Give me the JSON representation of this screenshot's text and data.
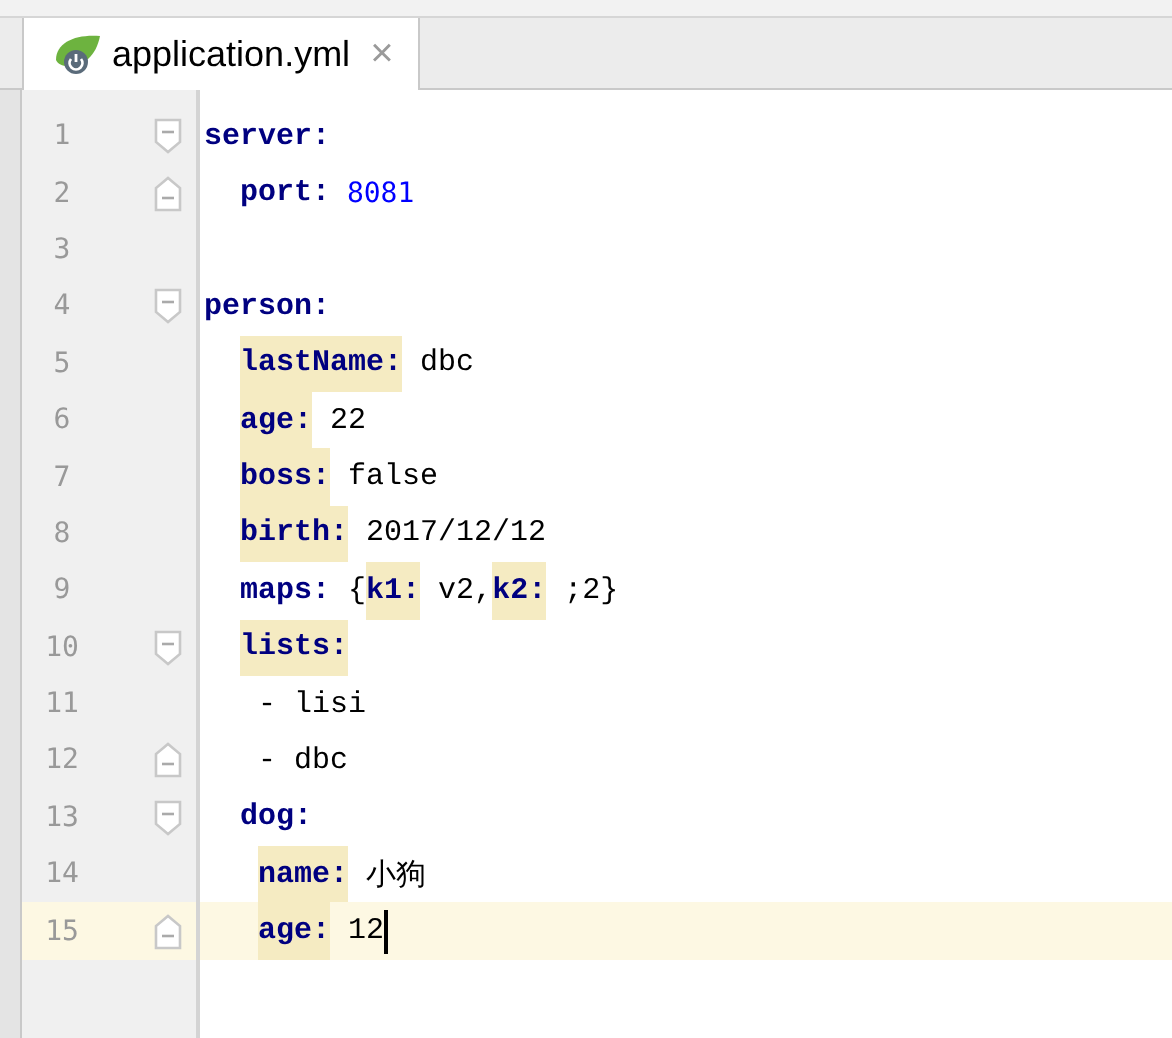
{
  "tabs": [
    {
      "label": "application.yml",
      "selected": true,
      "close": "×"
    }
  ],
  "lines": [
    {
      "number": "1",
      "fold_open": true,
      "fold_close": false,
      "current": false,
      "tokens": [
        {
          "kind": "key",
          "text": "server:",
          "highlighted": false
        }
      ],
      "children": [
        {
          "number": "2",
          "fold_open": false,
          "fold_close": true,
          "current": false,
          "tokens": [
            {
              "kind": "key",
              "text": "port:",
              "highlighted": false
            },
            {
              "kind": "number",
              "text": " 8081"
            }
          ]
        }
      ]
    },
    {
      "number": "3",
      "fold_open": false,
      "fold_close": false,
      "current": false
    },
    {
      "number": "4",
      "fold_open": true,
      "fold_close": false,
      "current": false,
      "tokens": [
        {
          "kind": "key",
          "text": "person:",
          "highlighted": false
        }
      ],
      "children": [
        {
          "number": "5",
          "fold_open": false,
          "fold_close": false,
          "current": false,
          "tokens": [
            {
              "kind": "key",
              "text": "lastName:",
              "highlighted": true
            },
            {
              "kind": "plain",
              "text": " dbc"
            }
          ]
        },
        {
          "number": "6",
          "fold_open": false,
          "fold_close": false,
          "current": false,
          "tokens": [
            {
              "kind": "key",
              "text": "age:",
              "highlighted": true
            },
            {
              "kind": "plain",
              "text": " 22"
            }
          ]
        },
        {
          "number": "7",
          "fold_open": false,
          "fold_close": false,
          "current": false,
          "tokens": [
            {
              "kind": "key",
              "text": "boss:",
              "highlighted": true
            },
            {
              "kind": "plain",
              "text": " false"
            }
          ]
        },
        {
          "number": "8",
          "fold_open": false,
          "fold_close": false,
          "current": false,
          "tokens": [
            {
              "kind": "key",
              "text": "birth:",
              "highlighted": true
            },
            {
              "kind": "plain",
              "text": " 2017/12/12"
            }
          ]
        },
        {
          "number": "9",
          "fold_open": false,
          "fold_close": false,
          "current": false,
          "tokens": [
            {
              "kind": "key",
              "text": "maps:",
              "highlighted": false
            },
            {
              "kind": "plain",
              "text": " {"
            },
            {
              "kind": "key",
              "text": "k1:",
              "highlighted": true
            },
            {
              "kind": "plain",
              "text": " v2,"
            },
            {
              "kind": "key",
              "text": "k2:",
              "highlighted": true
            },
            {
              "kind": "plain",
              "text": " ;2}"
            }
          ]
        },
        {
          "number": "10",
          "fold_open": true,
          "fold_close": false,
          "current": false,
          "tokens": [
            {
              "kind": "key",
              "text": "lists:",
              "highlighted": true
            }
          ],
          "children": [
            {
              "number": "11",
              "fold_open": false,
              "fold_close": false,
              "current": false,
              "tokens": [
                {
                  "kind": "plain",
                  "text": "- lisi"
                }
              ]
            },
            {
              "number": "12",
              "fold_open": false,
              "fold_close": true,
              "current": false,
              "tokens": [
                {
                  "kind": "plain",
                  "text": "- dbc"
                }
              ]
            }
          ]
        },
        {
          "number": "13",
          "fold_open": true,
          "fold_close": false,
          "current": false,
          "tokens": [
            {
              "kind": "key",
              "text": "dog:",
              "highlighted": false
            }
          ],
          "children": [
            {
              "number": "14",
              "fold_open": false,
              "fold_close": false,
              "current": false,
              "tokens": [
                {
                  "kind": "key",
                  "text": "name:",
                  "highlighted": true
                },
                {
                  "kind": "plain",
                  "text": " 小狗"
                }
              ]
            },
            {
              "number": "15",
              "fold_open": false,
              "fold_close": true,
              "current": true,
              "tokens": [
                {
                  "kind": "key",
                  "text": "age:",
                  "highlighted": true
                },
                {
                  "kind": "plain",
                  "text": " 12"
                }
              ]
            }
          ]
        }
      ]
    }
  ]
}
